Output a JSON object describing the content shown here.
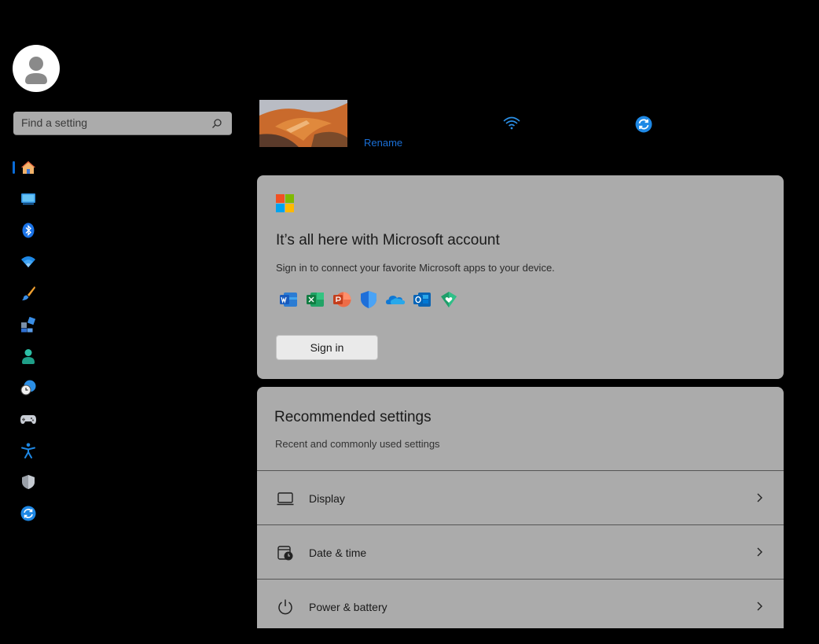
{
  "search": {
    "placeholder": "Find a setting"
  },
  "sidebar": {
    "items": [
      {
        "icon": "home-icon",
        "selected": true
      },
      {
        "icon": "system-icon"
      },
      {
        "icon": "bluetooth-icon"
      },
      {
        "icon": "network-icon"
      },
      {
        "icon": "personalization-icon"
      },
      {
        "icon": "apps-icon"
      },
      {
        "icon": "accounts-icon"
      },
      {
        "icon": "time-language-icon"
      },
      {
        "icon": "gaming-icon"
      },
      {
        "icon": "accessibility-icon"
      },
      {
        "icon": "privacy-security-icon"
      },
      {
        "icon": "windows-update-icon"
      }
    ]
  },
  "device": {
    "rename_label": "Rename"
  },
  "ms_account": {
    "title": "It’s all here with Microsoft account",
    "description": "Sign in to connect your favorite Microsoft apps to your device.",
    "sign_in_label": "Sign in",
    "apps": [
      "word-icon",
      "excel-icon",
      "powerpoint-icon",
      "defender-icon",
      "onedrive-icon",
      "outlook-icon",
      "family-safety-icon"
    ]
  },
  "recommended": {
    "title": "Recommended settings",
    "subtitle": "Recent and commonly used settings",
    "rows": [
      {
        "label": "Display",
        "icon": "display-icon"
      },
      {
        "label": "Date & time",
        "icon": "date-time-icon"
      },
      {
        "label": "Power & battery",
        "icon": "power-icon"
      }
    ]
  },
  "colors": {
    "accent": "#0a6cd8",
    "card": "#ababab",
    "background": "#000000"
  }
}
